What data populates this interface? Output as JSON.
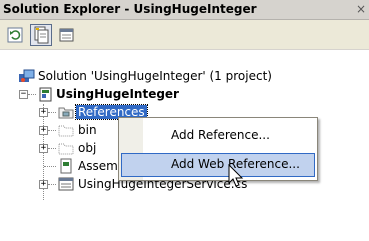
{
  "window": {
    "title": "Solution Explorer - UsingHugeInteger",
    "close_glyph": "×"
  },
  "toolbar": {
    "buttons": [
      {
        "name": "refresh-icon"
      },
      {
        "name": "show-all-files-icon"
      },
      {
        "name": "properties-icon"
      }
    ]
  },
  "tree": {
    "solution_label": "Solution 'UsingHugeInteger' (1 project)",
    "project_label": "UsingHugeInteger",
    "items": [
      {
        "label": "References",
        "icon": "references-folder-icon",
        "expander": "+"
      },
      {
        "label": "bin",
        "icon": "folder-icon",
        "expander": "+"
      },
      {
        "label": "obj",
        "icon": "folder-icon",
        "expander": "+"
      },
      {
        "label": "AssemblyInfo.cs",
        "icon": "cs-file-icon",
        "expander": ""
      },
      {
        "label": "UsingHugeIntegerService.cs",
        "icon": "service-file-icon",
        "expander": "+"
      }
    ],
    "project_expander": "−"
  },
  "context_menu": {
    "items": [
      {
        "label": "Add Reference..."
      },
      {
        "label": "Add Web Reference..."
      }
    ]
  }
}
